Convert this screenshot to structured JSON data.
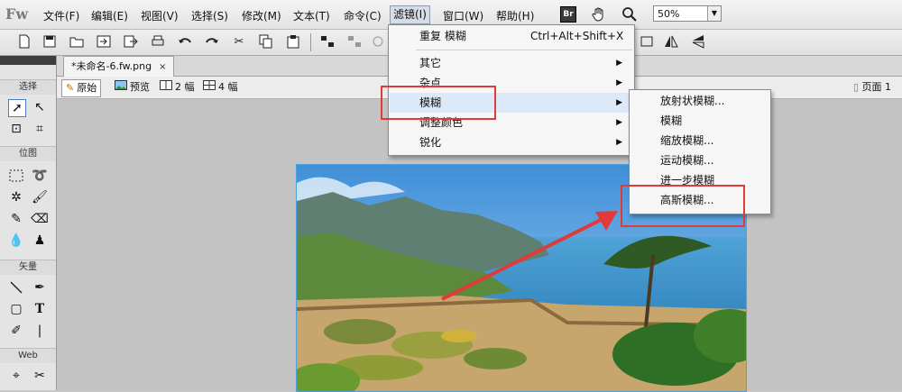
{
  "app": {
    "logo": "Fw"
  },
  "menubar": {
    "items": [
      "文件(F)",
      "编辑(E)",
      "视图(V)",
      "选择(S)",
      "修改(M)",
      "文本(T)",
      "命令(C)",
      "滤镜(I)",
      "窗口(W)",
      "帮助(H)"
    ],
    "br_label": "Br",
    "zoom_value": "50%"
  },
  "document": {
    "tab_title": "*未命名-6.fw.png",
    "close_glyph": "×"
  },
  "viewbar": {
    "original": "原始",
    "preview": "预览",
    "two_up": "2 幅",
    "four_up": "4 幅",
    "page": "页面 1"
  },
  "tools": {
    "sections": [
      "选择",
      "位图",
      "矢量",
      "Web"
    ]
  },
  "filter_menu": {
    "repeat_label": "重复 模糊",
    "repeat_shortcut": "Ctrl+Alt+Shift+X",
    "items": [
      "其它",
      "杂点",
      "模糊",
      "调整颜色",
      "锐化"
    ],
    "highlighted": "模糊"
  },
  "blur_submenu": {
    "items": [
      "放射状模糊...",
      "模糊",
      "缩放模糊...",
      "运动模糊...",
      "进一步模糊",
      "高斯模糊..."
    ],
    "target": "高斯模糊..."
  },
  "colors": {
    "annotation_red": "#e03a3a",
    "selection_blue": "#4aa3df"
  }
}
